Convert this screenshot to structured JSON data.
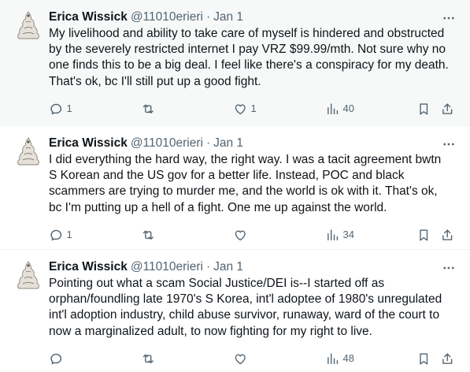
{
  "tweets": [
    {
      "author_name": "Erica Wissick",
      "author_handle": "@11010erieri",
      "separator": "·",
      "date": "Jan 1",
      "text": "My livelihood and ability to take care of myself is hindered and obstructed by the severely restricted internet I pay VRZ $99.99/mth. Not sure why no one finds this to be a big deal. I feel like there's a conspiracy for my death. That's ok, bc I'll still put up a good fight.",
      "replies": "1",
      "reposts": "",
      "likes": "1",
      "views": "40",
      "highlighted": true
    },
    {
      "author_name": "Erica Wissick",
      "author_handle": "@11010erieri",
      "separator": "·",
      "date": "Jan 1",
      "text": "I did everything the hard way, the right way. I was a tacit agreement bwtn S Korean and the US gov for a better life. Instead, POC and black scammers are trying to murder me, and the world is ok with it. That's ok, bc I'm putting up a hell of a fight. One me up against the world.",
      "replies": "1",
      "reposts": "",
      "likes": "",
      "views": "34",
      "highlighted": false
    },
    {
      "author_name": "Erica Wissick",
      "author_handle": "@11010erieri",
      "separator": "·",
      "date": "Jan 1",
      "text": "Pointing out what a scam Social Justice/DEI is--I started off as orphan/foundling late 1970's S Korea, int'l adoptee of 1980's unregulated int'l adoption industry, child abuse survivor, runaway, ward of the court to now a marginalized adult, to now fighting for my right to live.",
      "replies": "",
      "reposts": "",
      "likes": "",
      "views": "48",
      "highlighted": false
    }
  ],
  "icons": {
    "more": "more-dots-icon",
    "reply": "reply-icon",
    "repost": "repost-icon",
    "like": "heart-icon",
    "views": "views-bar-icon",
    "bookmark": "bookmark-icon",
    "share": "share-icon"
  },
  "colors": {
    "text_primary": "#0f1419",
    "text_secondary": "#536471",
    "highlight_bg": "#f7f9f9",
    "divider": "#eff3f4"
  }
}
